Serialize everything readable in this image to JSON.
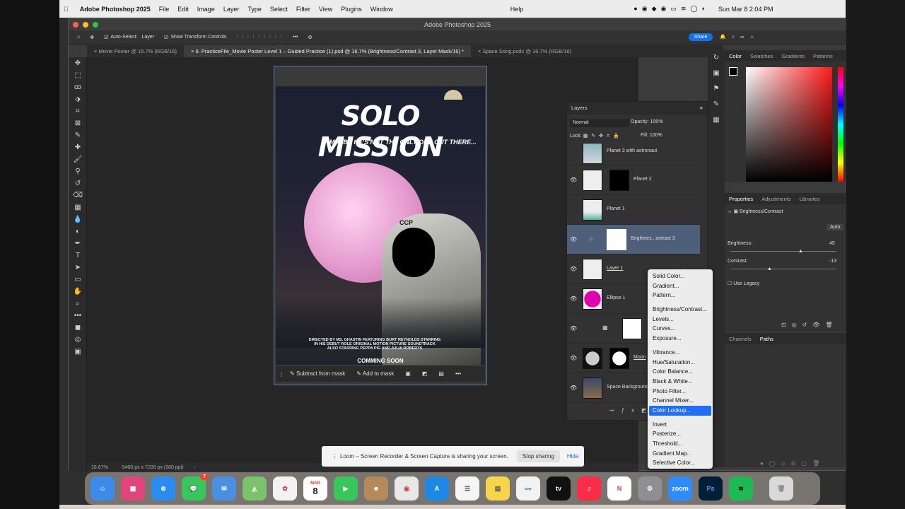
{
  "menubar": {
    "apple": "",
    "app_name": "Adobe Photoshop 2025",
    "items": [
      "File",
      "Edit",
      "Image",
      "Layer",
      "Type",
      "Select",
      "Filter",
      "View",
      "Plugins",
      "Window"
    ],
    "help": "Help",
    "clock": "Sun Mar 8  2:04 PM"
  },
  "window": {
    "title": "Adobe Photoshop 2025",
    "options": {
      "auto_select": "Auto-Select:",
      "layer_select": "Layer",
      "show_transform": "Show Transform Controls",
      "share": "Share"
    },
    "tabs": [
      "Movie Poster @ 16.7% (RGB/16)",
      "9. PracticeFile_Movie Poster Level 1 – Guided Practice (1).psd @ 16.7% (Brightness/Contrast 3, Layer Mask/16) *",
      "Space Song.psdc @ 16.7% (RGB/16)"
    ]
  },
  "poster": {
    "title": "SOLO MISSION",
    "tagline": "MAYBE HE'S NOT THE ONLY ONE OUT THERE...",
    "credits": [
      "DIRECTED BY MS. GHASTIN  FEATURING BURT REYNOLDS STARRING",
      "IN HIS DEBUT ROLE ORIGINAL MOTION PICTURE SOUNDTRACK",
      "ALSO STARRING PEPPA PIG AND JULIA ROBERTS"
    ],
    "coming": "COMMING SOON",
    "helmet_text": "CCP"
  },
  "maskbar": {
    "subtract": "Subtract from mask",
    "add": "Add to mask"
  },
  "status": {
    "zoom": "16.67%",
    "size": "5400 px x 7200 px (300 ppi)"
  },
  "layers_panel": {
    "title": "Layers",
    "blend": "Normal",
    "opacity_label": "Opacity:",
    "opacity": "100%",
    "lock_label": "Lock:",
    "fill_label": "Fill:",
    "fill": "100%",
    "layers": [
      {
        "name": "Planet 3 with astronaut"
      },
      {
        "name": "Planet 2"
      },
      {
        "name": "Planet 1"
      },
      {
        "name": "Brightnes...ontrast 3"
      },
      {
        "name": "Layer 1"
      },
      {
        "name": "Ellipse 1"
      },
      {
        "name": ""
      },
      {
        "name": "Moon"
      },
      {
        "name": "Space Background"
      }
    ]
  },
  "color_panel": {
    "tabs": [
      "Color",
      "Swatches",
      "Gradients",
      "Patterns"
    ]
  },
  "properties": {
    "tabs": [
      "Properties",
      "Adjustments",
      "Libraries"
    ],
    "type": "Brightness/Contrast",
    "auto": "Auto",
    "brightness_label": "Brightness:",
    "brightness": "45",
    "contrast_label": "Contrast:",
    "contrast": "-13",
    "legacy": "Use Legacy"
  },
  "channels": {
    "tabs": [
      "Channels",
      "Paths"
    ]
  },
  "adj_menu": {
    "group1": [
      "Solid Color...",
      "Gradient...",
      "Pattern..."
    ],
    "group2": [
      "Brightness/Contrast...",
      "Levels...",
      "Curves...",
      "Exposure..."
    ],
    "group3": [
      "Vibrance...",
      "Hue/Saturation...",
      "Color Balance...",
      "Black & White...",
      "Photo Filter...",
      "Channel Mixer...",
      "Color Lookup..."
    ],
    "group4": [
      "Invert",
      "Posterize...",
      "Threshold...",
      "Gradient Map...",
      "Selective Color..."
    ]
  },
  "loom": {
    "message": "Loom – Screen Recorder & Screen Capture is sharing your screen.",
    "stop": "Stop sharing",
    "hide": "Hide"
  },
  "dock": {
    "calendar_month": "MAR",
    "calendar_day": "8",
    "messages_badge": "7",
    "zoom": "zoom",
    "ps": "Ps"
  },
  "colors": {
    "accent": "#1f6ff5",
    "moon": "#e49bcf",
    "ellipse": "#e000b0"
  }
}
